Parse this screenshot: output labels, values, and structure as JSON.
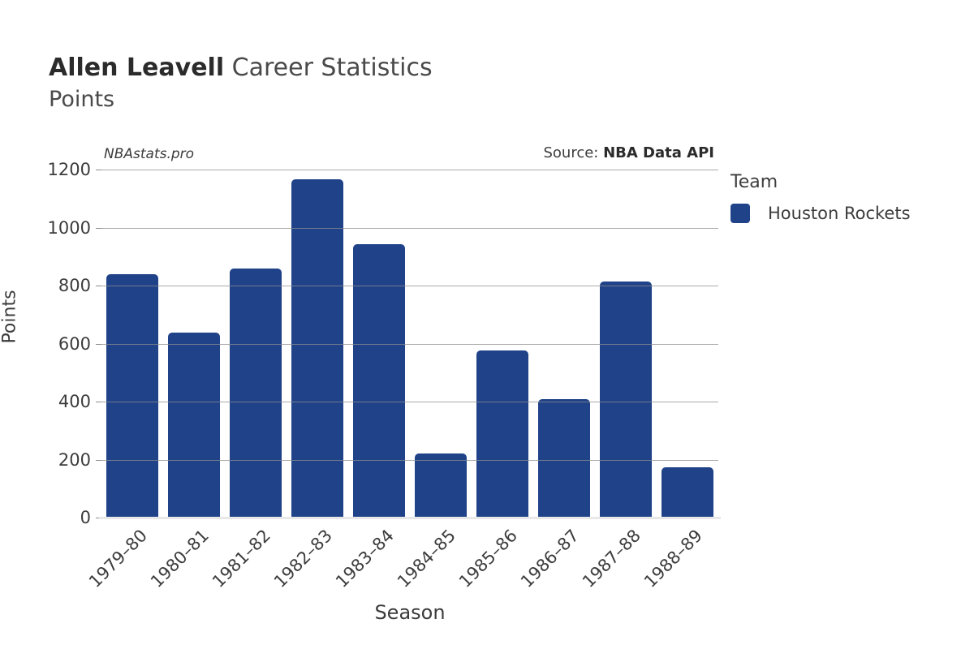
{
  "header": {
    "player_name": "Allen Leavell",
    "title_suffix": " Career Statistics",
    "subtitle": "Points"
  },
  "annotations": {
    "watermark": "NBAstats.pro",
    "source_label": "Source: ",
    "source_value": "NBA Data API"
  },
  "legend": {
    "title": "Team",
    "entries": [
      {
        "label": "Houston Rockets",
        "color": "#1f4289"
      }
    ]
  },
  "chart_data": {
    "type": "bar",
    "title": "Allen Leavell Career Statistics",
    "subtitle": "Points",
    "xlabel": "Season",
    "ylabel": "Points",
    "ylim": [
      0,
      1200
    ],
    "yticks": [
      0,
      200,
      400,
      600,
      800,
      1000,
      1200
    ],
    "grid": true,
    "legend_position": "right",
    "series_name": "Houston Rockets",
    "bar_color": "#1f4289",
    "categories": [
      "1979–80",
      "1980–81",
      "1981–82",
      "1982–83",
      "1983–84",
      "1984–85",
      "1985–86",
      "1986–87",
      "1987–88",
      "1988–89"
    ],
    "values": [
      839,
      638,
      859,
      1166,
      943,
      221,
      576,
      408,
      814,
      173
    ]
  }
}
